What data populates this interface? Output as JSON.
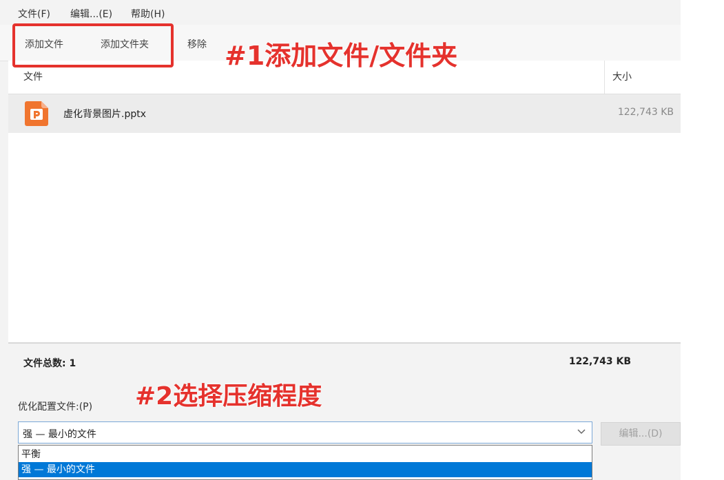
{
  "menu": [
    "文件(F)",
    "编辑...(E)",
    "帮助(H)"
  ],
  "toolbar": {
    "add_file": "添加文件",
    "add_folder": "添加文件夹",
    "remove": "移除"
  },
  "annotations": {
    "step1": "#1添加文件/文件夹",
    "step2": "#2选择压缩程度"
  },
  "list": {
    "col_name": "文件",
    "col_size": "大小",
    "rows": [
      {
        "name": "虚化背景图片.pptx",
        "size": "122,743 KB",
        "icon": "pptx-file-icon"
      }
    ]
  },
  "footer": {
    "total_label": "文件总数: 1",
    "total_size": "122,743 KB"
  },
  "profile": {
    "label": "优化配置文件:(P)",
    "selected": "强 — 最小的文件",
    "options": [
      "平衡",
      "强 — 最小的文件"
    ],
    "edit_label": "编辑...(D)"
  },
  "colors": {
    "annotation": "#e5322d",
    "highlight": "#0078d7",
    "ppt_icon": "#f0752f"
  }
}
